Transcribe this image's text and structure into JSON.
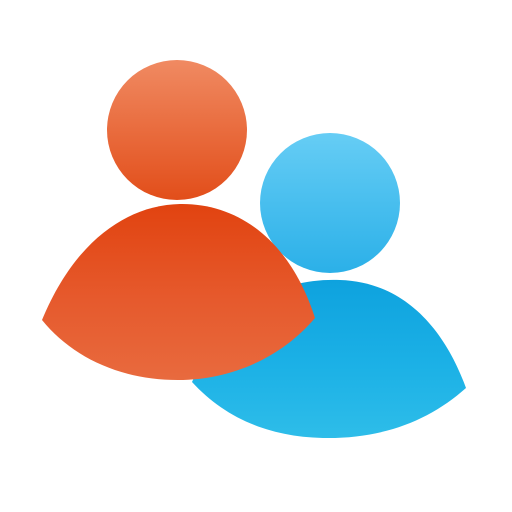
{
  "icon": {
    "name": "contacts-people-icon",
    "people": [
      {
        "name": "orange-person-icon",
        "head_gradient": [
          "#f08a62",
          "#e24e1a"
        ],
        "body_gradient": [
          "#e14310",
          "#e65a2d",
          "#e86a3e"
        ]
      },
      {
        "name": "blue-person-icon",
        "head_gradient": [
          "#66cdf5",
          "#2bb0e8"
        ],
        "body_gradient": [
          "#0ea2de",
          "#1cb1e6",
          "#2ebde9"
        ]
      }
    ],
    "background": "#ffffff"
  }
}
